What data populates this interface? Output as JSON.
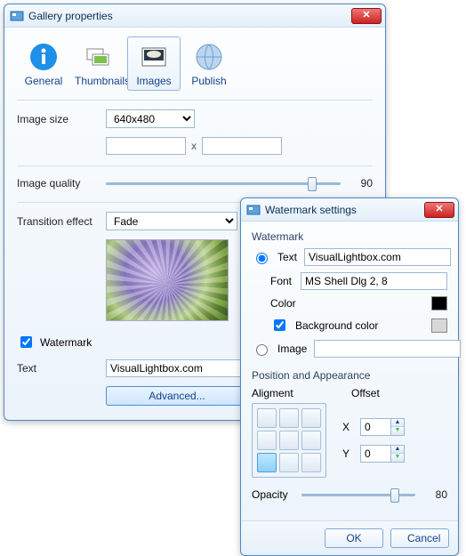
{
  "win1": {
    "title": "Gallery properties",
    "tabs": {
      "general": "General",
      "thumbs": "Thumbnails",
      "images": "Images",
      "publish": "Publish"
    },
    "imageSizeLabel": "Image size",
    "imageSizeValue": "640x480",
    "width": "",
    "height": "",
    "mul": "x",
    "qualityLabel": "Image quality",
    "qualityValue": "90",
    "transitionLabel": "Transition effect",
    "transitionValue": "Fade",
    "watermarkChkLabel": "Watermark",
    "textLabel": "Text",
    "textValue": "VisualLightbox.com",
    "advancedLabel": "Advanced..."
  },
  "win2": {
    "title": "Watermark settings",
    "grpWatermark": "Watermark",
    "optText": "Text",
    "textValue": "VisualLightbox.com",
    "fontLabel": "Font",
    "fontValue": "MS Shell Dlg 2, 8",
    "colorLabel": "Color",
    "colorValue": "#000000",
    "bgColorLabel": "Background color",
    "bgColorValue": "#d8d8d8",
    "optImage": "Image",
    "imagePath": "",
    "browse": "...",
    "grpPA": "Position and Appearance",
    "alignLabel": "Aligment",
    "offsetLabel": "Offset",
    "xLabel": "X",
    "xValue": "0",
    "yLabel": "Y",
    "yValue": "0",
    "opacityLabel": "Opacity",
    "opacityValue": "80",
    "ok": "OK",
    "cancel": "Cancel"
  }
}
